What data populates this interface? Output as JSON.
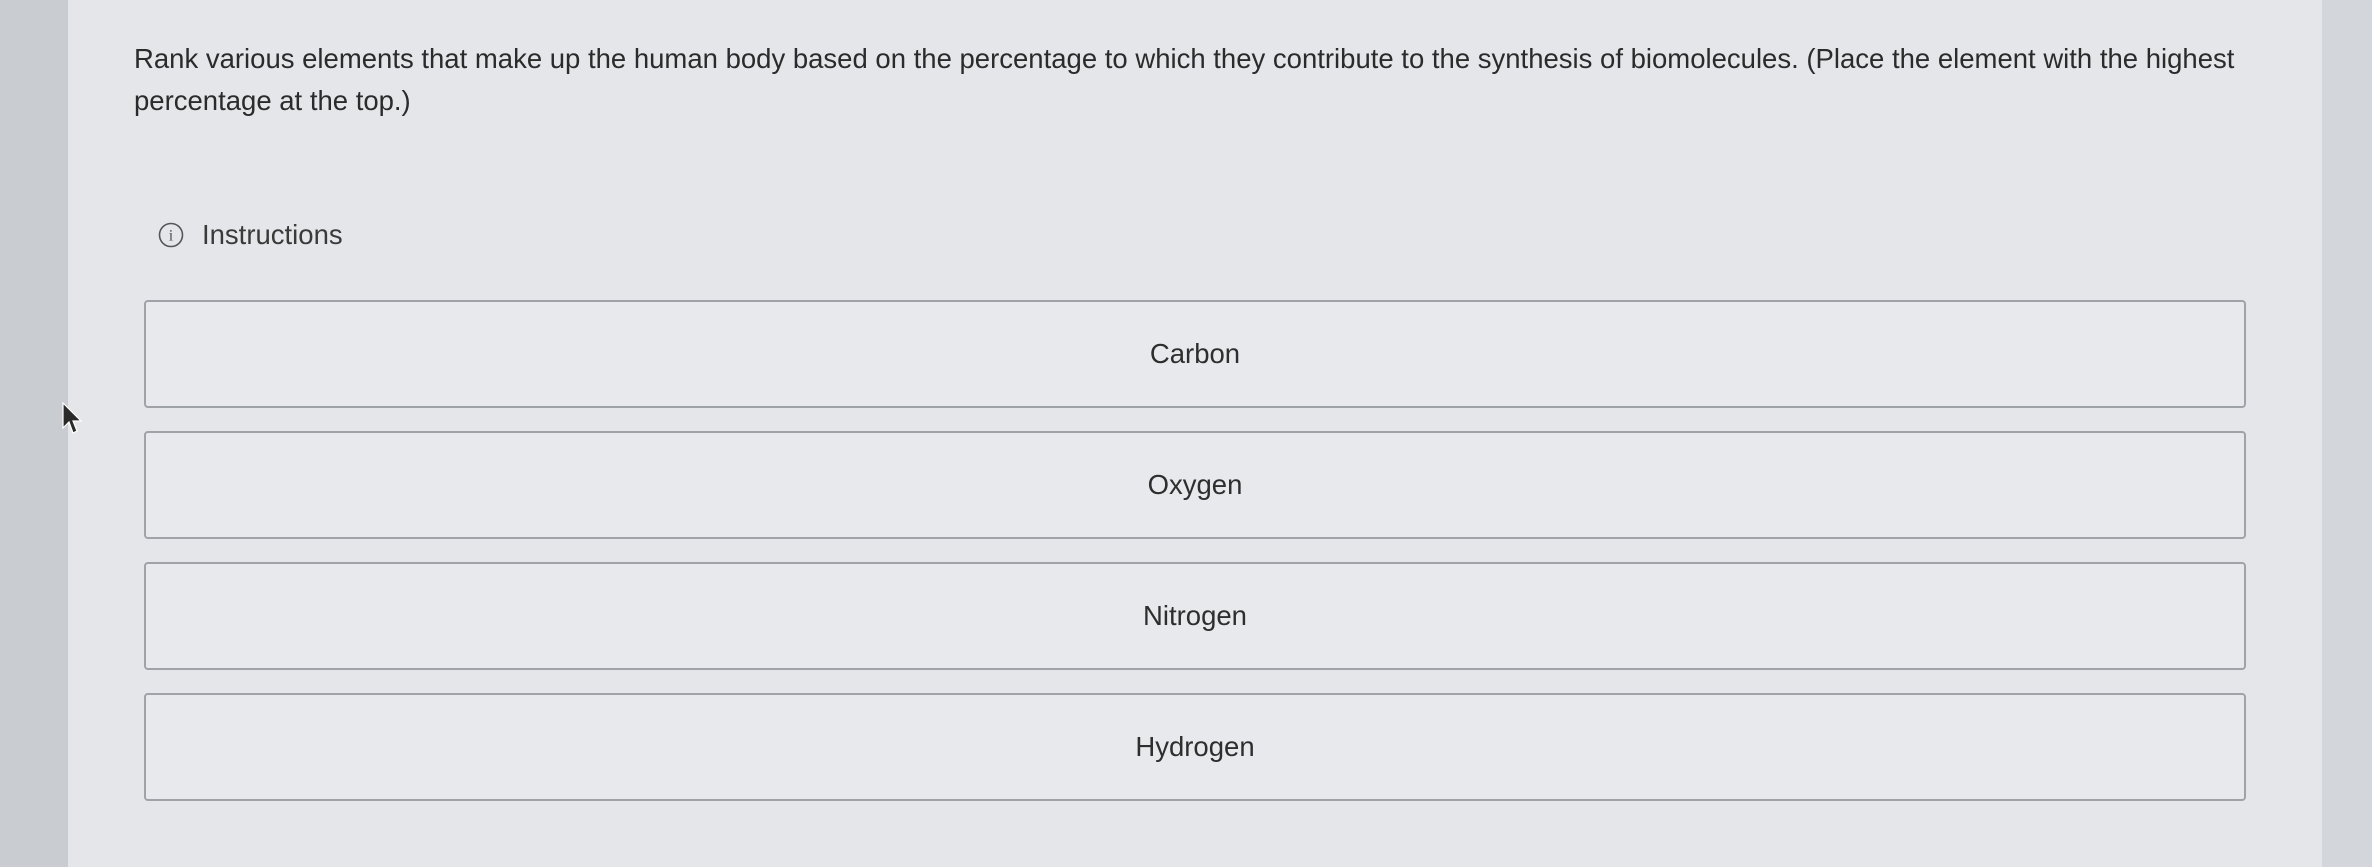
{
  "question": {
    "prompt": "Rank various elements that make up the human body based on the percentage to which they contribute to the synthesis of biomolecules. (Place the element with the highest percentage at the top.)"
  },
  "instructions": {
    "label": "Instructions",
    "icon": "info-icon"
  },
  "ranking": {
    "items": [
      {
        "label": "Carbon"
      },
      {
        "label": "Oxygen"
      },
      {
        "label": "Nitrogen"
      },
      {
        "label": "Hydrogen"
      }
    ]
  },
  "colors": {
    "page_background": "#e4e6ea",
    "item_border": "#9fa3a8",
    "text": "#2b2b2b"
  }
}
